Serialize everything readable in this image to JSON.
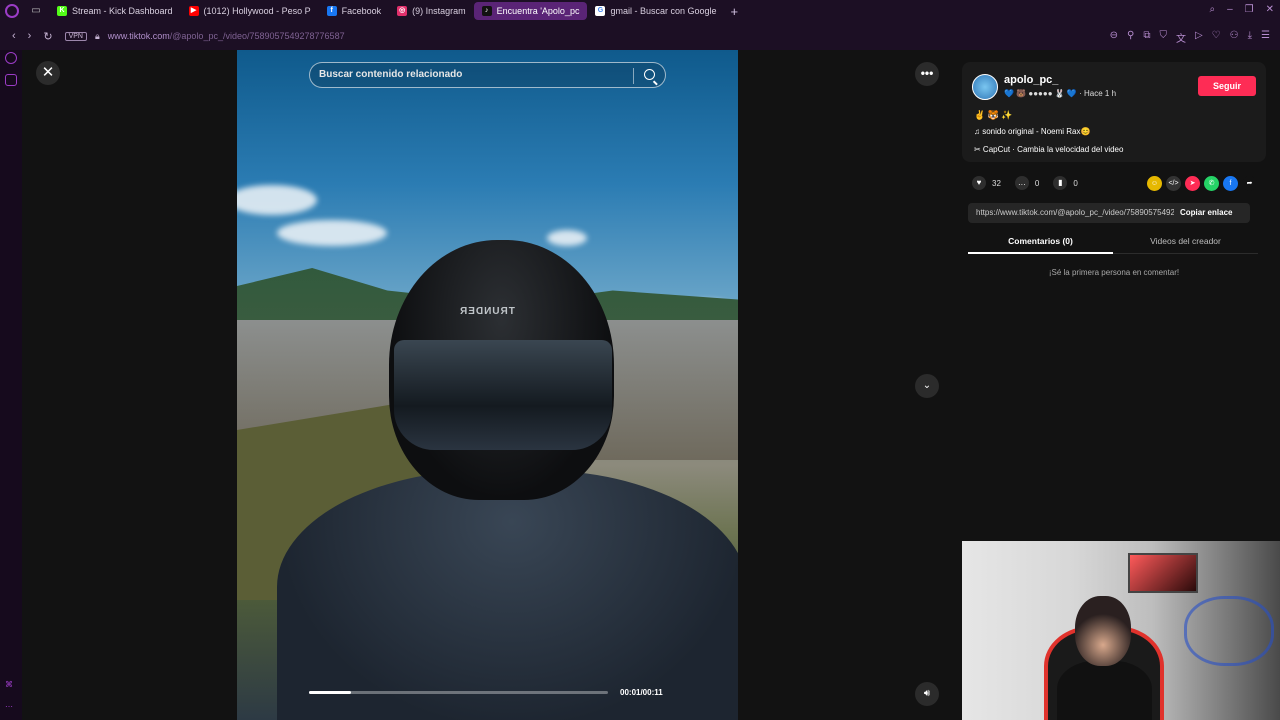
{
  "browser": {
    "tabs": [
      {
        "label": "Stream - Kick Dashboard",
        "color": "#53fc18",
        "glyph": "K"
      },
      {
        "label": "(1012) Hollywood - Peso P",
        "color": "#ff0000",
        "glyph": "▶"
      },
      {
        "label": "Facebook",
        "color": "#1877f2",
        "glyph": "f"
      },
      {
        "label": "(9) Instagram",
        "color": "#e1306c",
        "glyph": "◎"
      },
      {
        "label": "Encuentra 'Apolo_pc",
        "color": "#111111",
        "glyph": "♪"
      },
      {
        "label": "gmail - Buscar con Google",
        "color": "#ffffff",
        "glyph": "G"
      }
    ],
    "active_tab_index": 4,
    "vpn_label": "VPN",
    "url_domain": "www.tiktok.com",
    "url_path": "/@apolo_pc_/video/7589057549278776587"
  },
  "video": {
    "search_placeholder": "Buscar contenido relacionado",
    "helmet_text": "TRUNDER",
    "time": "00:01/00:11",
    "progress": 0.14
  },
  "panel": {
    "username": "apolo_pc_",
    "meta": "💙 🐻 ●●●●● 🐰 💙 · Hace 1 h",
    "follow_label": "Seguir",
    "description": "✌️ 🐯 ✨",
    "sound": "♫  sonido original - Noemi Rax😊",
    "capcut": "✂  CapCut · Cambia la velocidad del video",
    "likes": "32",
    "comments": "0",
    "saves": "0",
    "link": "https://www.tiktok.com/@apolo_pc_/video/7589057549278776587",
    "copy_label": "Copiar enlace",
    "tab_comments": "Comentarios (0)",
    "tab_creator": "Videos del creador",
    "empty_comments": "¡Sé la primera persona en comentar!",
    "share_icons": [
      {
        "name": "embed-icon",
        "color": "#e6b800",
        "glyph": "☺"
      },
      {
        "name": "code-icon",
        "color": "#333333",
        "glyph": "</>"
      },
      {
        "name": "send-icon",
        "color": "#fe2c55",
        "glyph": "➤"
      },
      {
        "name": "whatsapp-icon",
        "color": "#25d366",
        "glyph": "✆"
      },
      {
        "name": "facebook-icon",
        "color": "#1877f2",
        "glyph": "f"
      },
      {
        "name": "share-arrow-icon",
        "color": "#121212",
        "glyph": "➦"
      }
    ]
  },
  "colors": {
    "accent": "#fe2c55",
    "browser_bg": "#1c0f24",
    "page_bg": "#121212"
  }
}
